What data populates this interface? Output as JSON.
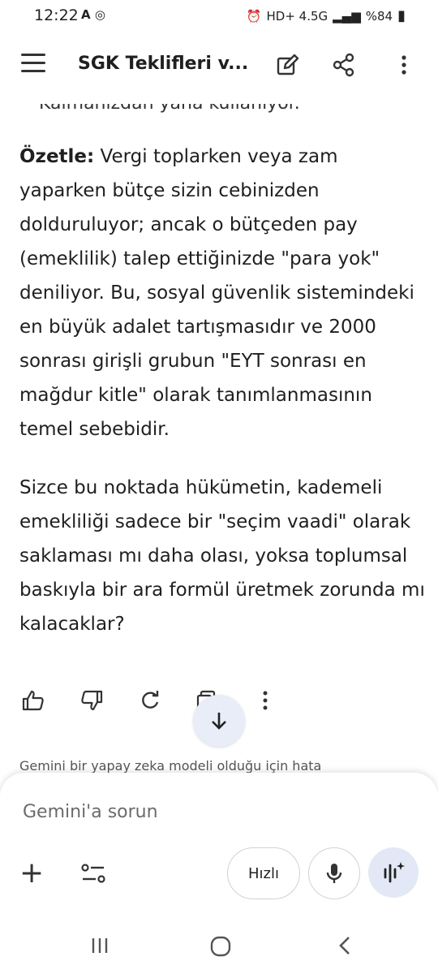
{
  "status": {
    "time": "12:22",
    "left_indicators": "A ◎",
    "network": "HD+ 4.5G",
    "battery": "%84"
  },
  "appbar": {
    "title": "SGK Teklifleri v..."
  },
  "content": {
    "cut_line": "Kalmanızdan yana kullanıyor.",
    "p1_bold": "Özetle:",
    "p1_text": " Vergi toplarken veya zam yaparken bütçe sizin cebinizden dolduruluyor; ancak o bütçeden pay (emeklilik) talep ettiğinizde \"para yok\" deniliyor. Bu, sosyal güvenlik sistemindeki en büyük adalet tartışmasıdır ve 2000 sonrası girişli grubun \"EYT sonrası en mağdur kitle\" olarak tanımlanmasının temel sebebidir.",
    "p2_text": "Sizce bu noktada hükümetin, kademeli emekliliği sadece bir \"seçim vaadi\" olarak saklaması mı daha olası, yoksa toplumsal baskıyla bir ara formül üretmek zorunda mı kalacaklar?"
  },
  "disclaimer": "Gemini bir yapay zeka modeli olduğu için hata",
  "input": {
    "placeholder": "Gemini'a sorun",
    "mode_label": "Hızlı"
  },
  "icons": [
    "menu-icon",
    "edit-icon",
    "share-icon",
    "more-vert-icon",
    "thumb-up-icon",
    "thumb-down-icon",
    "regenerate-icon",
    "copy-icon",
    "more-icon",
    "arrow-down-icon",
    "plus-icon",
    "tune-icon",
    "mic-icon",
    "live-icon",
    "recents-icon",
    "home-icon",
    "back-icon"
  ],
  "colors": {
    "accent_bg": "#e3e8f6",
    "text": "#1f1f1f"
  }
}
